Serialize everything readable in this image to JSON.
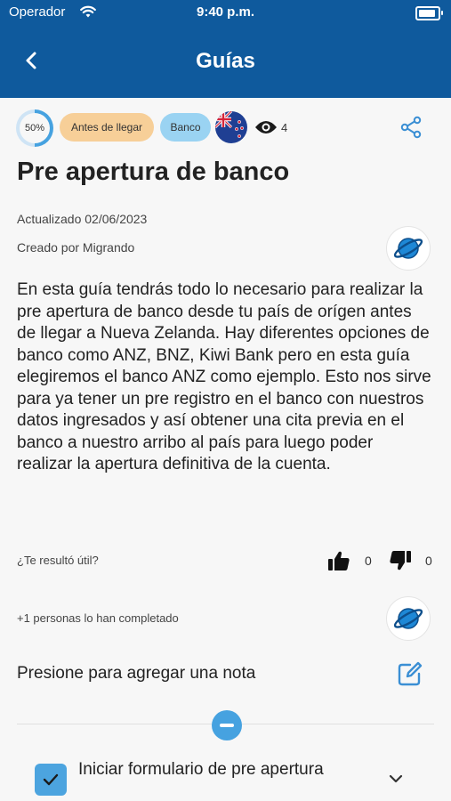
{
  "status_bar": {
    "carrier": "Operador",
    "time": "9:40 p.m."
  },
  "header": {
    "title": "Guías"
  },
  "tags": {
    "progress_label": "50%",
    "progress_value": 0.5,
    "stage": "Antes de llegar",
    "category": "Banco",
    "views": "4"
  },
  "guide": {
    "title": "Pre apertura de banco",
    "updated": "Actualizado 02/06/2023",
    "created_by": "Creado por Migrando",
    "description": "En esta guía tendrás todo lo necesario para realizar la pre apertura de banco desde tu país de orígen antes de llegar a Nueva Zelanda. Hay diferentes opciones de banco como ANZ, BNZ, Kiwi Bank pero en esta guía elegiremos el banco ANZ como ejemplo. Esto nos sirve para ya tener un pre registro en el banco con nuestros datos ingresados y así obtener una cita previa en el banco a nuestro arribo al país para luego poder realizar la apertura definitiva de la cuenta."
  },
  "feedback": {
    "question": "¿Te resultó útil?",
    "likes": "0",
    "dislikes": "0"
  },
  "completed_text": "+1 personas lo han completado",
  "note_prompt": "Presione para agregar una nota",
  "steps": [
    {
      "title": "Iniciar formulario de pre apertura",
      "checked": true
    }
  ],
  "colors": {
    "header": "#0f5a9d",
    "accent": "#46a2e0",
    "chip_orange": "#f7cf98",
    "chip_blue": "#9ad3f2"
  }
}
